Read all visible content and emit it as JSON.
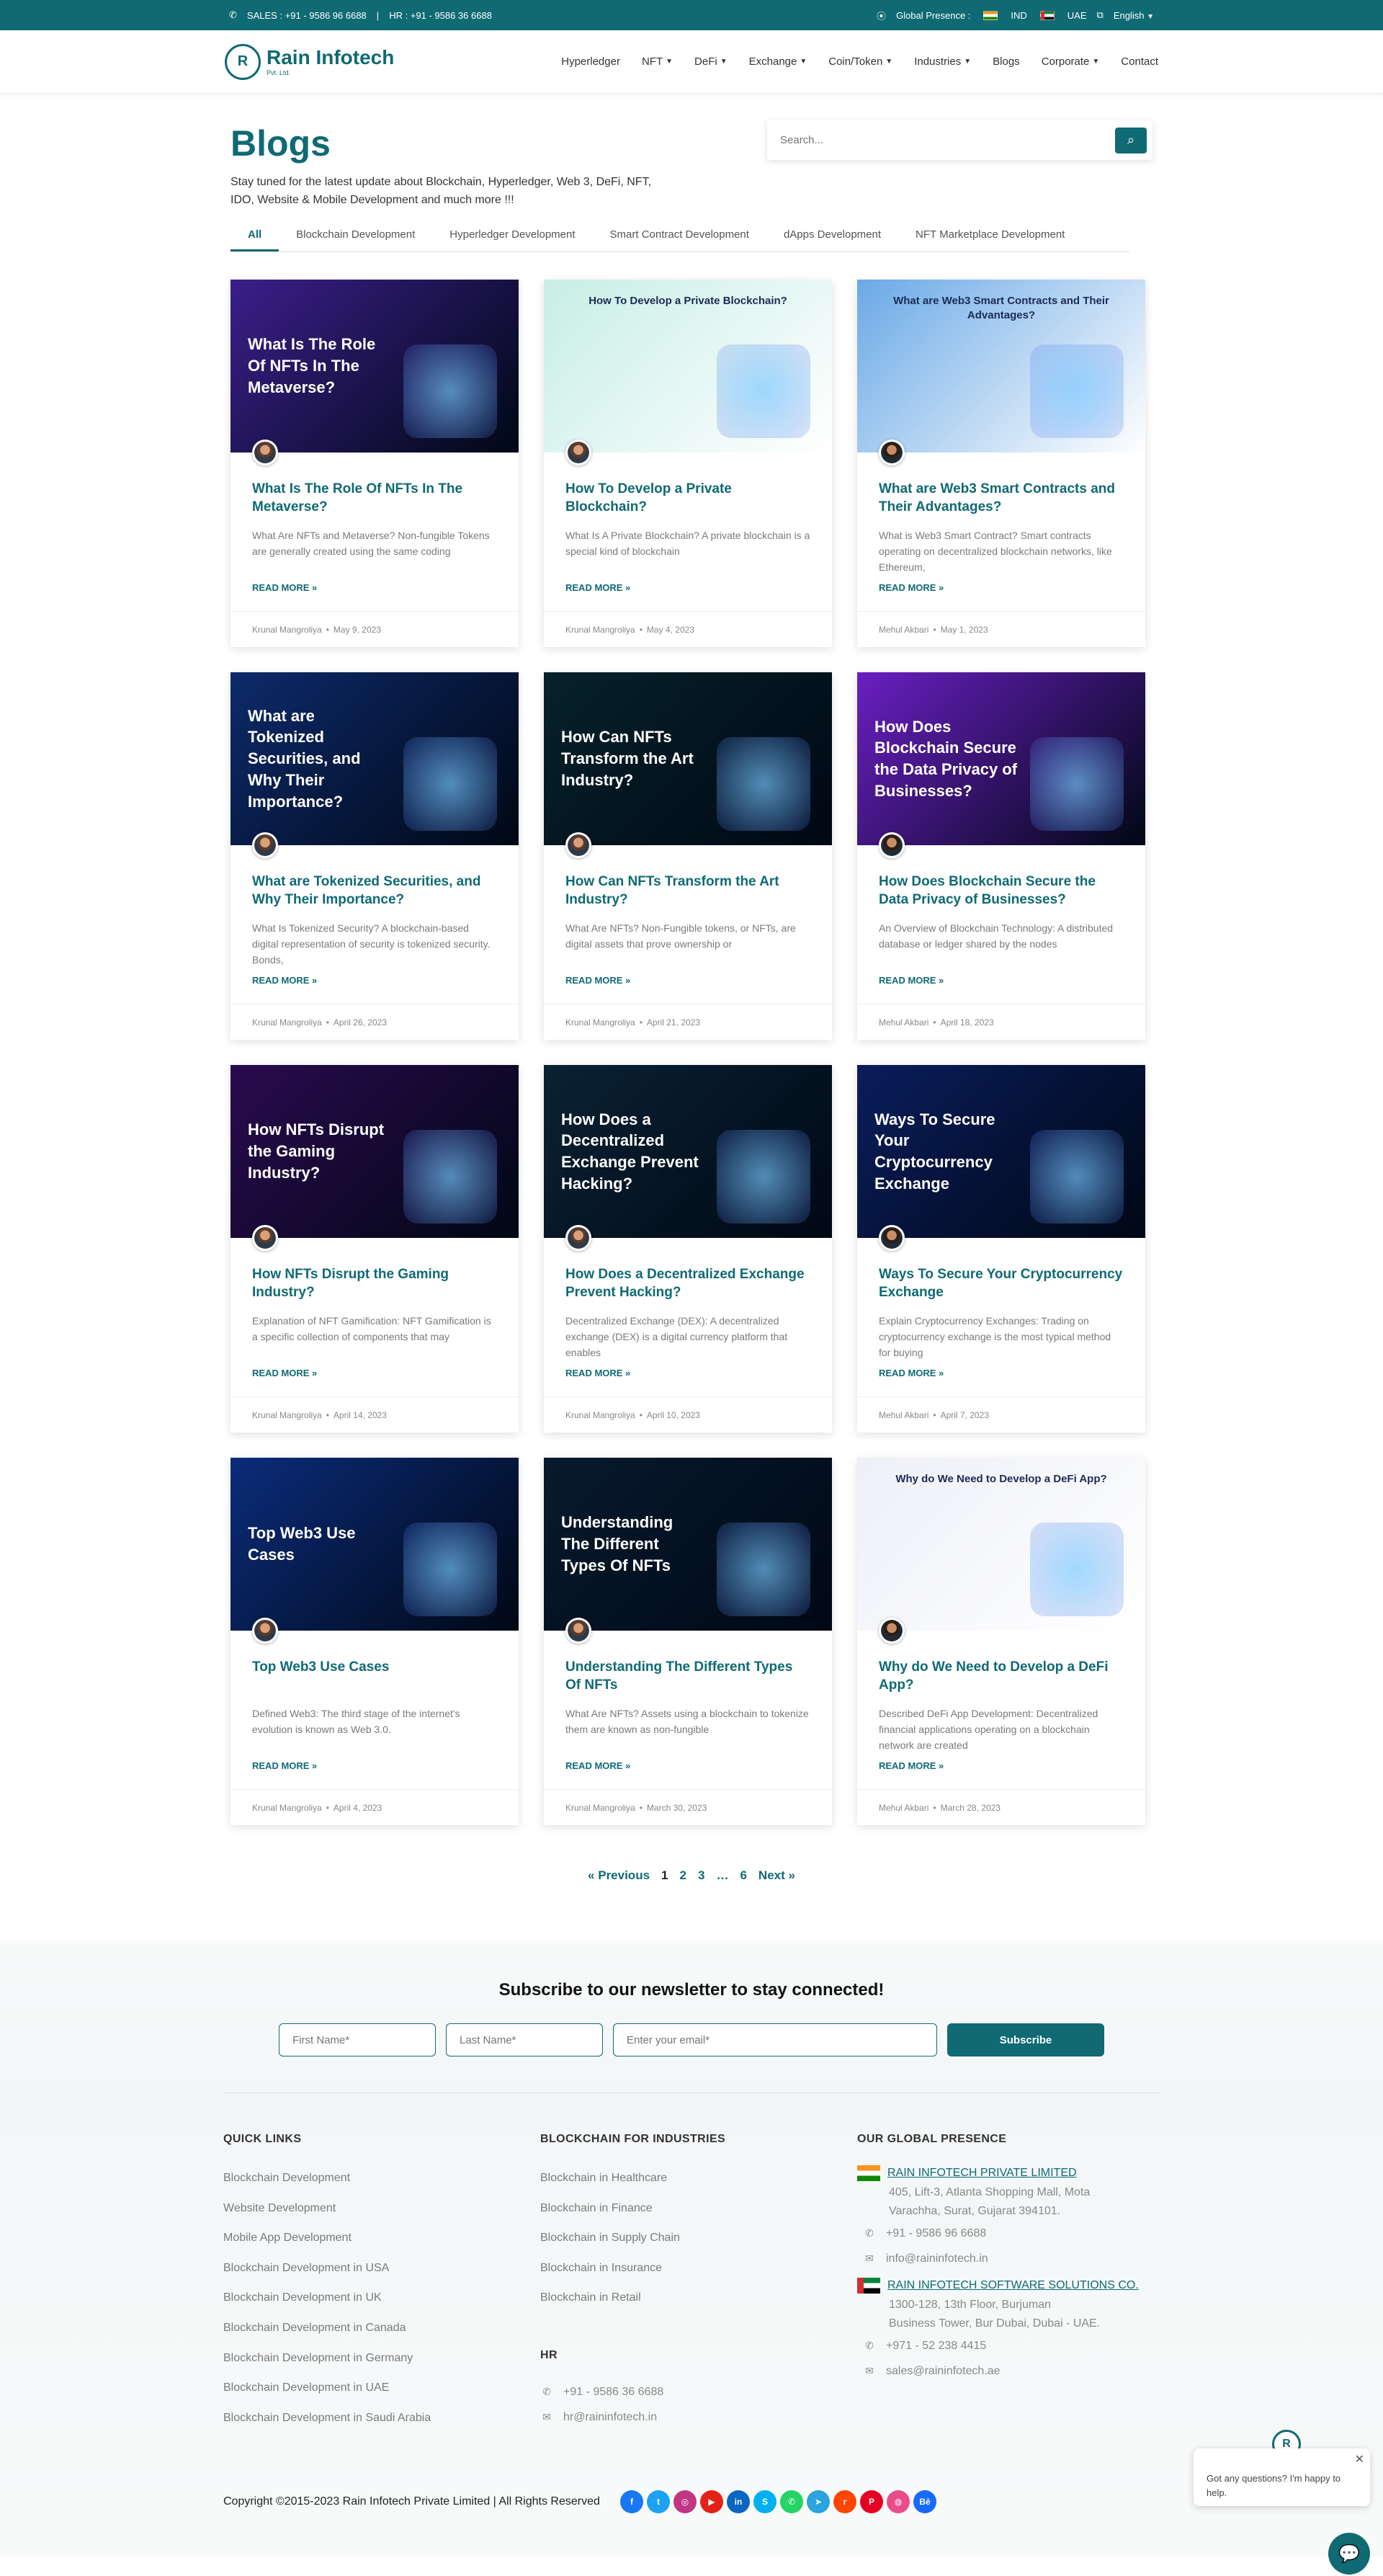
{
  "topbar": {
    "sales": "SALES : +91 - 9586 96 6688",
    "hr": "HR : +91 - 9586 36 6688",
    "global_presence": "Global Presence :",
    "ind": "IND",
    "uae": "UAE",
    "language": "English"
  },
  "header": {
    "logo_name": "Rain Infotech",
    "logo_sub": "Pvt. Ltd.",
    "nav": [
      {
        "label": "Hyperledger"
      },
      {
        "label": "NFT"
      },
      {
        "label": "DeFi"
      },
      {
        "label": "Exchange"
      },
      {
        "label": "Coin/Token"
      },
      {
        "label": "Industries"
      },
      {
        "label": "Blogs"
      },
      {
        "label": "Corporate"
      },
      {
        "label": "Contact"
      }
    ]
  },
  "hero": {
    "title": "Blogs",
    "subtitle": "Stay tuned for the latest update about Blockchain, Hyperledger, Web 3, DeFi, NFT, IDO, Website & Mobile Development and much more !!!",
    "search_placeholder": "Search..."
  },
  "tabs": [
    "All",
    "Blockchain Development",
    "Hyperledger Development",
    "Smart Contract Development",
    "dApps Development",
    "NFT Marketplace Development"
  ],
  "posts": [
    {
      "img_caption": "What Is The Role Of NFTs In The Metaverse?",
      "title": "What Is The Role Of NFTs In The Metaverse?",
      "excerpt": "What Are NFTs and Metaverse? Non-fungible Tokens are generally created using the same coding",
      "read_more": "READ MORE »",
      "author": "Krunal Mangroliya",
      "date": "May 9, 2023",
      "bg": "#3a1f8a"
    },
    {
      "img_caption": "How To Develop a Private Blockchain?",
      "title": "How To Develop a Private Blockchain?",
      "excerpt": "What Is A Private Blockchain? A private blockchain is a special kind of blockchain",
      "read_more": "READ MORE »",
      "author": "Krunal Mangroliya",
      "date": "May 4, 2023",
      "bg": "#c7eee6"
    },
    {
      "img_caption": "What are Web3 Smart Contracts and Their Advantages?",
      "title": "What are Web3 Smart Contracts and Their Advantages?",
      "excerpt": "What is Web3 Smart Contract? Smart contracts operating on decentralized blockchain networks, like Ethereum,",
      "read_more": "READ MORE »",
      "author": "Mehul Akbari",
      "date": "May 1, 2023",
      "bg": "#6aa9e6"
    },
    {
      "img_caption": "What are Tokenized Securities, and Why Their Importance?",
      "title": "What are Tokenized Securities, and Why Their Importance?",
      "excerpt": "What Is Tokenized Security? A blockchain-based digital representation of security is tokenized security. Bonds,",
      "read_more": "READ MORE »",
      "author": "Krunal Mangroliya",
      "date": "April 26, 2023",
      "bg": "#0d2a6b"
    },
    {
      "img_caption": "How Can NFTs Transform the Art Industry?",
      "title": "How Can NFTs Transform the Art Industry?",
      "excerpt": "What Are NFTs? Non-Fungible tokens, or NFTs, are digital assets that prove ownership or",
      "read_more": "READ MORE »",
      "author": "Krunal Mangroliya",
      "date": "April 21, 2023",
      "bg": "#06222a"
    },
    {
      "img_caption": "How Does Blockchain Secure the Data Privacy of Businesses?",
      "title": "How Does Blockchain Secure the Data Privacy of Businesses?",
      "excerpt": "An Overview of Blockchain Technology: A distributed database or ledger shared by the nodes",
      "read_more": "READ MORE »",
      "author": "Mehul Akbari",
      "date": "April 18, 2023",
      "bg": "#6a1fc2"
    },
    {
      "img_caption": "How NFTs Disrupt the Gaming Industry?",
      "title": "How NFTs Disrupt the Gaming Industry?",
      "excerpt": "Explanation of NFT Gamification: NFT Gamification is a specific collection of components that may",
      "read_more": "READ MORE »",
      "author": "Krunal Mangroliya",
      "date": "April 14, 2023",
      "bg": "#2a0a4f"
    },
    {
      "img_caption": "How Does a Decentralized Exchange Prevent Hacking?",
      "title": "How Does a Decentralized Exchange Prevent Hacking?",
      "excerpt": "Decentralized Exchange (DEX): A decentralized exchange (DEX) is a digital currency platform that enables",
      "read_more": "READ MORE »",
      "author": "Krunal Mangroliya",
      "date": "April 10, 2023",
      "bg": "#0a2233"
    },
    {
      "img_caption": "Ways To Secure Your Cryptocurrency Exchange",
      "title": "Ways To Secure Your Cryptocurrency Exchange",
      "excerpt": "Explain Cryptocurrency Exchanges: Trading on cryptocurrency exchange is the most typical method for buying",
      "read_more": "READ MORE »",
      "author": "Mehul Akbari",
      "date": "April 7, 2023",
      "bg": "#0a1d5c"
    },
    {
      "img_caption": "Top Web3 Use Cases",
      "title": "Top Web3 Use Cases",
      "excerpt": "Defined Web3: The third stage of the internet's evolution is known as Web 3.0.",
      "read_more": "READ MORE »",
      "author": "Krunal Mangroliya",
      "date": "April 4, 2023",
      "bg": "#0b2c7a"
    },
    {
      "img_caption": "Understanding The Different Types Of NFTs",
      "title": "Understanding The Different Types Of NFTs",
      "excerpt": "What Are NFTs? Assets using a blockchain to tokenize them are known as non-fungible",
      "read_more": "READ MORE »",
      "author": "Krunal Mangroliya",
      "date": "March 30, 2023",
      "bg": "#071a2e"
    },
    {
      "img_caption": "Why do We Need to Develop a DeFi App?",
      "title": "Why do We Need to Develop a DeFi App?",
      "excerpt": "Described DeFi App Development: Decentralized financial applications operating on a blockchain network are created",
      "read_more": "READ MORE »",
      "author": "Mehul Akbari",
      "date": "March 28, 2023",
      "bg": "#eef0f7"
    }
  ],
  "pagination": {
    "prev": "« Previous",
    "pages": [
      "1",
      "2",
      "3",
      "…",
      "6"
    ],
    "next": "Next »"
  },
  "newsletter": {
    "title": "Subscribe to our newsletter to stay connected!",
    "first_name": "First Name*",
    "last_name": "Last Name*",
    "email": "Enter your email*",
    "button": "Subscribe"
  },
  "footer": {
    "quick_links_title": "QUICK LINKS",
    "quick_links": [
      "Blockchain Development",
      "Website Development",
      "Mobile App Development",
      "Blockchain Development in USA",
      "Blockchain Development in UK",
      "Blockchain Development in Canada",
      "Blockchain Development in Germany",
      "Blockchain Development in UAE",
      "Blockchain Development in Saudi Arabia"
    ],
    "industries_title": "BLOCKCHAIN FOR INDUSTRIES",
    "industries": [
      "Blockchain in Healthcare",
      "Blockchain in Finance",
      "Blockchain in Supply Chain",
      "Blockchain in Insurance",
      "Blockchain in Retail"
    ],
    "hr_title": "HR",
    "hr_phone": "+91 - 9586 36 6688",
    "hr_email": "hr@raininfotech.in",
    "global_title": "OUR GLOBAL PRESENCE",
    "office_india_name": "RAIN INFOTECH PRIVATE LIMITED",
    "office_india_addr1": "405, Lift-3, Atlanta Shopping Mall, Mota",
    "office_india_addr2": "Varachha, Surat, Gujarat 394101.",
    "office_india_phone": "+91 - 9586 96 6688",
    "office_india_email": "info@raininfotech.in",
    "office_uae_name": "RAIN INFOTECH SOFTWARE SOLUTIONS CO.",
    "office_uae_addr1": "1300-128, 13th Floor, Burjuman",
    "office_uae_addr2": "Business Tower, Bur Dubai, Dubai - UAE.",
    "office_uae_phone": "+971 - 52 238 4415",
    "office_uae_email": "sales@raininfotech.ae",
    "copyright": "Copyright ©2015-2023 Rain Infotech Private Limited | All Rights Reserved"
  },
  "social": [
    {
      "name": "facebook-icon",
      "glyph": "f",
      "color": "#1877f2"
    },
    {
      "name": "twitter-icon",
      "glyph": "t",
      "color": "#1da1f2"
    },
    {
      "name": "instagram-icon",
      "glyph": "◎",
      "color": "#c13584"
    },
    {
      "name": "youtube-icon",
      "glyph": "▶",
      "color": "#e62117"
    },
    {
      "name": "linkedin-icon",
      "glyph": "in",
      "color": "#0a66c2"
    },
    {
      "name": "skype-icon",
      "glyph": "S",
      "color": "#00aff0"
    },
    {
      "name": "whatsapp-icon",
      "glyph": "✆",
      "color": "#25d366"
    },
    {
      "name": "telegram-icon",
      "glyph": "➤",
      "color": "#2aa3df"
    },
    {
      "name": "reddit-icon",
      "glyph": "r",
      "color": "#ff4500"
    },
    {
      "name": "pinterest-icon",
      "glyph": "P",
      "color": "#e60023"
    },
    {
      "name": "dribbble-icon",
      "glyph": "◍",
      "color": "#ea4c89"
    },
    {
      "name": "behance-icon",
      "glyph": "Bē",
      "color": "#1769ff"
    }
  ],
  "chat": {
    "message": "Got any questions? I'm happy to help.",
    "close": "✕"
  }
}
